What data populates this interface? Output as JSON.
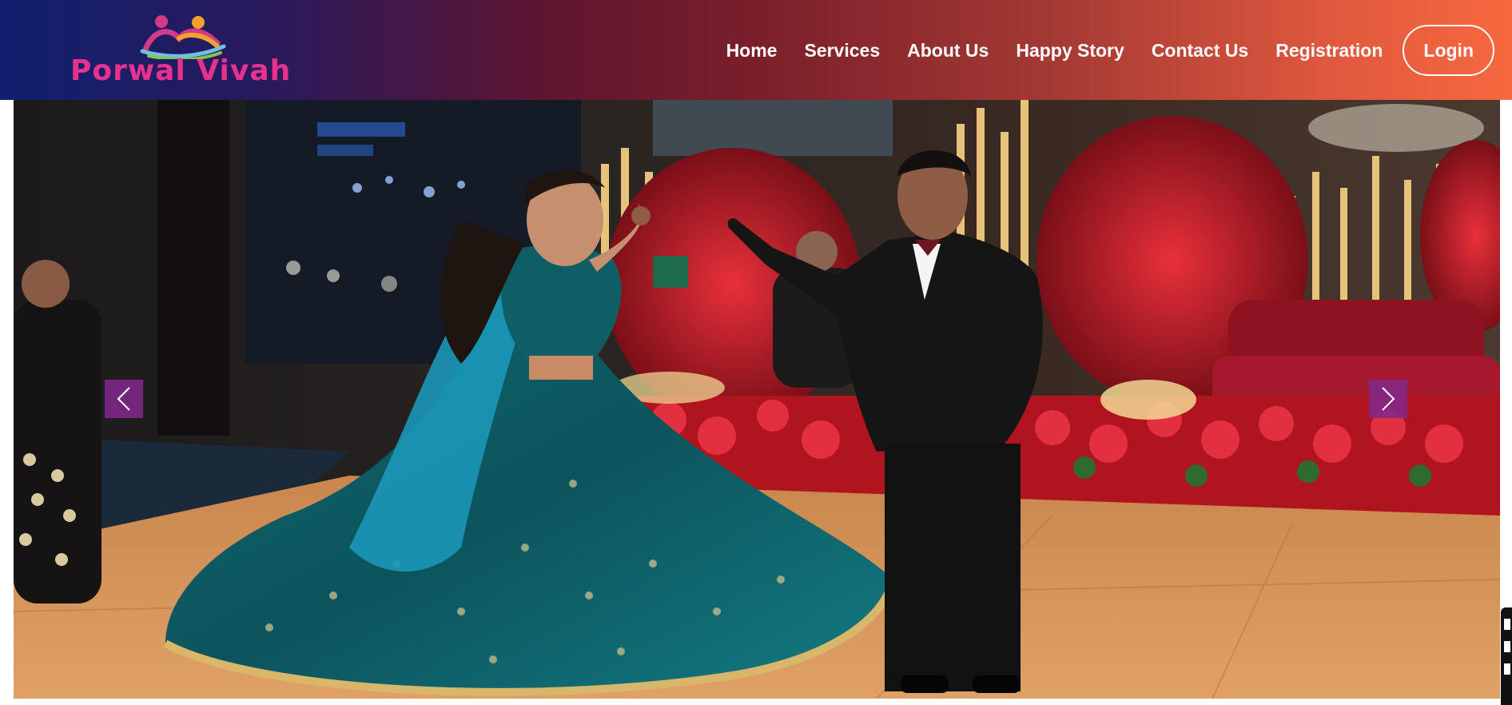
{
  "brand": {
    "name": "Porwal Vivah"
  },
  "nav": {
    "items": [
      {
        "label": "Home"
      },
      {
        "label": "Services"
      },
      {
        "label": "About Us"
      },
      {
        "label": "Happy Story"
      },
      {
        "label": "Contact Us"
      },
      {
        "label": "Registration"
      }
    ],
    "login_label": "Login"
  },
  "carousel": {
    "prev_icon": "chevron-left-icon",
    "next_icon": "chevron-right-icon"
  },
  "colors": {
    "brand_pink": "#e8318f",
    "arrow_bg": "#82288c",
    "header_left": "#10206e",
    "header_right": "#f7683f"
  }
}
